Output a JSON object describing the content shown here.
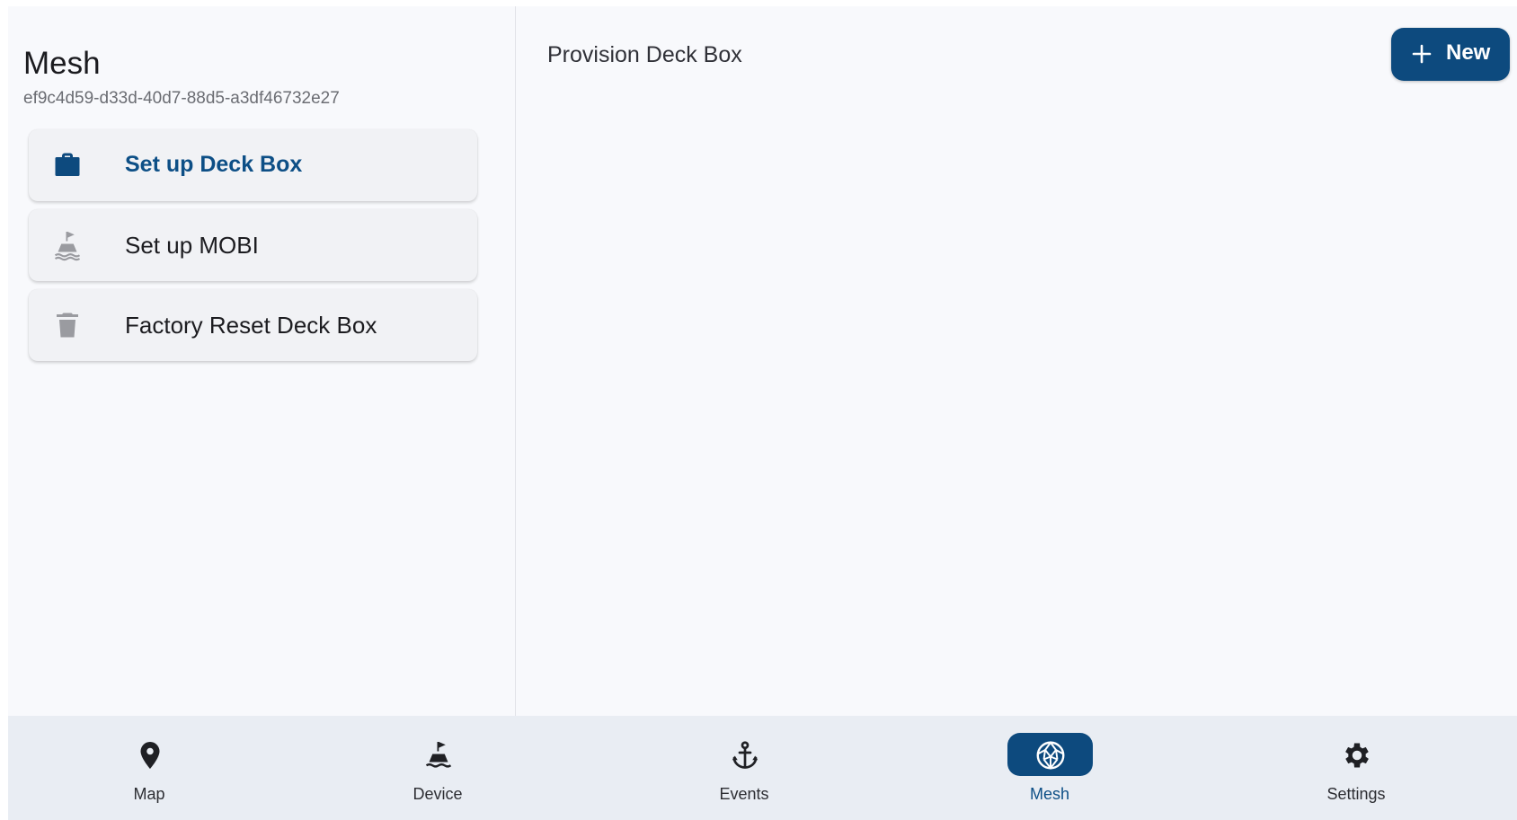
{
  "left_panel": {
    "title": "Mesh",
    "mesh_id": "ef9c4d59-d33d-40d7-88d5-a3df46732e27",
    "items": [
      {
        "label": "Set up Deck Box",
        "icon": "briefcase-icon",
        "active": true
      },
      {
        "label": "Set up MOBI",
        "icon": "buoy-icon",
        "active": false
      },
      {
        "label": "Factory Reset Deck Box",
        "icon": "trash-icon",
        "active": false
      }
    ]
  },
  "main": {
    "title": "Provision Deck Box",
    "new_button_label": "New",
    "new_button_icon": "plus-icon"
  },
  "bottom_nav": {
    "items": [
      {
        "label": "Map",
        "icon": "map-pin-icon",
        "active": false
      },
      {
        "label": "Device",
        "icon": "buoy-icon",
        "active": false
      },
      {
        "label": "Events",
        "icon": "anchor-icon",
        "active": false
      },
      {
        "label": "Mesh",
        "icon": "mesh-icon",
        "active": true
      },
      {
        "label": "Settings",
        "icon": "gear-icon",
        "active": false
      }
    ]
  },
  "colors": {
    "accent": "#0d4a7e",
    "accent_text": "#0d4f86",
    "background": "#f8f9fc",
    "nav_background": "#e9edf3",
    "inactive_icon": "#9a9ba0"
  }
}
